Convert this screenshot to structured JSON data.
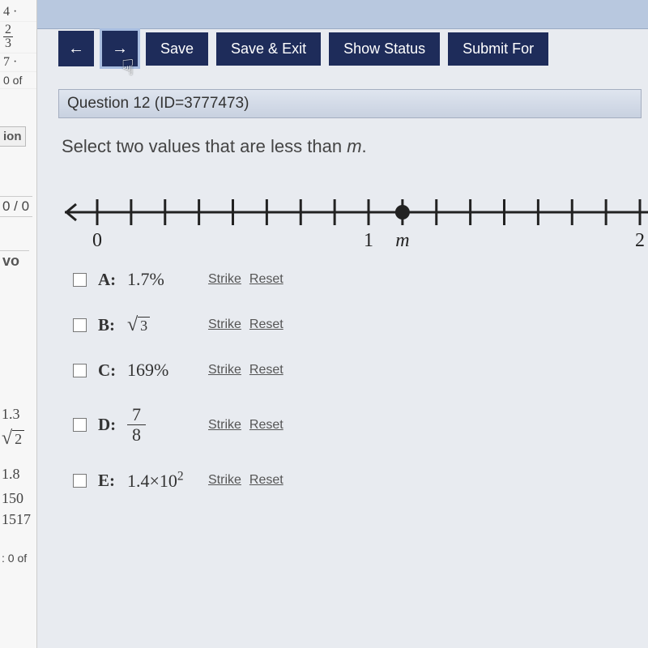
{
  "toolbar": {
    "back_icon": "←",
    "forward_icon": "→",
    "save": "Save",
    "save_exit": "Save & Exit",
    "show_status": "Show Status",
    "submit": "Submit For"
  },
  "left_strip": {
    "items": [
      "4 ·",
      "2/3",
      "7 ·",
      "0 of",
      "ion",
      "0 / 0",
      "vo",
      "",
      "1.3",
      "√2",
      "1.8",
      "150",
      "15/17",
      ": 0 of"
    ]
  },
  "question": {
    "header": "Question 12 (ID=3777473)",
    "prompt_pre": "Select two values that are less than ",
    "prompt_var": "m",
    "prompt_post": "."
  },
  "numberline": {
    "ticks": [
      "0",
      "",
      "",
      "",
      "",
      "",
      "",
      "",
      "1",
      "m",
      "",
      "",
      "",
      "",
      "",
      "",
      "2"
    ],
    "m_position_index": 9,
    "labeled": {
      "0": "0",
      "8": "1",
      "9": "m",
      "16": "2"
    }
  },
  "choices": [
    {
      "key": "A",
      "value_text": "1.7%",
      "type": "text"
    },
    {
      "key": "B",
      "value_text": "√3",
      "type": "sqrt",
      "radicand": "3"
    },
    {
      "key": "C",
      "value_text": "169%",
      "type": "text"
    },
    {
      "key": "D",
      "value_text": "7/8",
      "type": "fraction",
      "num": "7",
      "den": "8"
    },
    {
      "key": "E",
      "value_text": "1.4×10^2",
      "type": "sci",
      "mantissa": "1.4",
      "base": "10",
      "exp": "2"
    }
  ],
  "links": {
    "strike": "Strike",
    "reset": "Reset"
  }
}
